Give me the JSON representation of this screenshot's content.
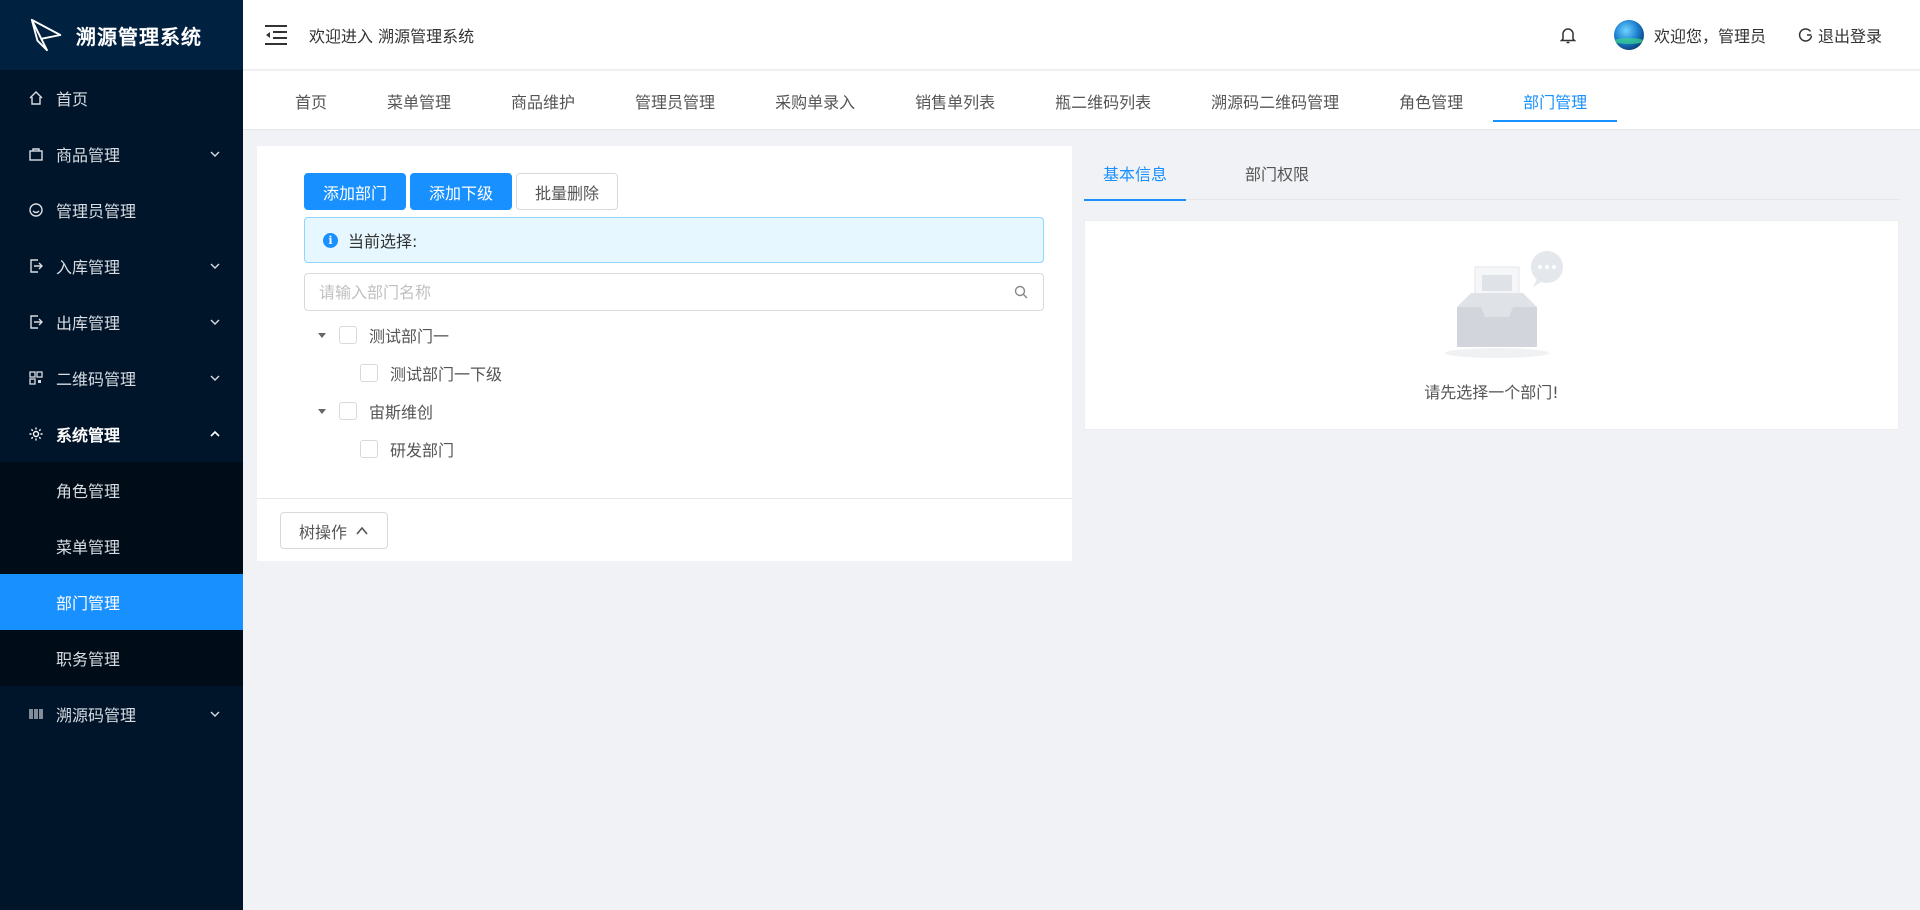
{
  "app": {
    "title": "溯源管理系统"
  },
  "sidebar": {
    "items": [
      {
        "label": "首页",
        "icon": "home-icon"
      },
      {
        "label": "商品管理",
        "icon": "bag-icon"
      },
      {
        "label": "管理员管理",
        "icon": "smile-icon"
      },
      {
        "label": "入库管理",
        "icon": "login-icon"
      },
      {
        "label": "出库管理",
        "icon": "logout-icon"
      },
      {
        "label": "二维码管理",
        "icon": "qrcode-icon"
      },
      {
        "label": "系统管理",
        "icon": "gear-icon"
      },
      {
        "label": "溯源码管理",
        "icon": "barcode-icon"
      }
    ],
    "system_sub": [
      {
        "label": "角色管理"
      },
      {
        "label": "菜单管理"
      },
      {
        "label": "部门管理"
      },
      {
        "label": "职务管理"
      }
    ]
  },
  "header": {
    "welcome": "欢迎进入 溯源管理系统",
    "user_greeting": "欢迎您，管理员",
    "logout": "退出登录"
  },
  "tabs": [
    "首页",
    "菜单管理",
    "商品维护",
    "管理员管理",
    "采购单录入",
    "销售单列表",
    "瓶二维码列表",
    "溯源码二维码管理",
    "角色管理",
    "部门管理"
  ],
  "dept": {
    "buttons": {
      "add": "添加部门",
      "add_child": "添加下级",
      "batch_delete": "批量删除"
    },
    "current_selection": "当前选择:",
    "search_placeholder": "请输入部门名称",
    "tree": [
      {
        "label": "测试部门一",
        "children": [
          {
            "label": "测试部门一下级"
          }
        ]
      },
      {
        "label": "宙斯维创",
        "children": [
          {
            "label": "研发部门"
          }
        ]
      }
    ],
    "tree_op": "树操作"
  },
  "detail": {
    "tabs": [
      "基本信息",
      "部门权限"
    ],
    "empty_text": "请先选择一个部门!"
  },
  "colors": {
    "primary": "#1890ff",
    "sidebar_bg": "#001529",
    "submenu_bg": "#000c17"
  }
}
